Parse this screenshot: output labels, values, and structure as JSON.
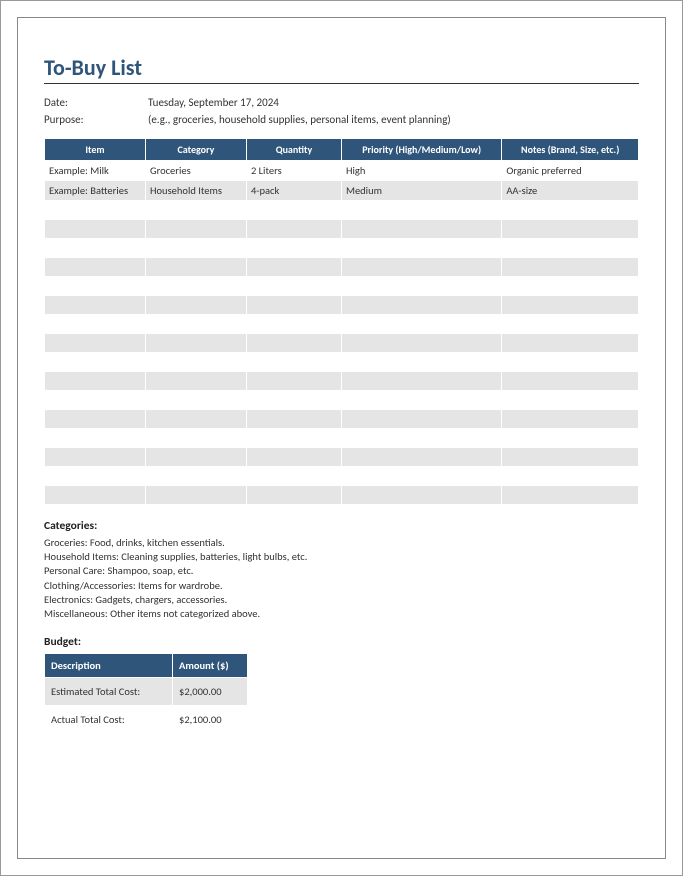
{
  "title": "To-Buy List",
  "meta": {
    "date_label": "Date:",
    "date_value": "Tuesday, September 17, 2024",
    "purpose_label": "Purpose:",
    "purpose_value": "(e.g., groceries, household supplies, personal items, event planning)"
  },
  "table": {
    "headers": {
      "item": "Item",
      "category": "Category",
      "quantity": "Quantity",
      "priority": "Priority (High/Medium/Low)",
      "notes": "Notes (Brand, Size, etc.)"
    },
    "rows": [
      {
        "item": "Example: Milk",
        "category": "Groceries",
        "quantity": "2 Liters",
        "priority": "High",
        "notes": "Organic preferred"
      },
      {
        "item": "Example: Batteries",
        "category": "Household Items",
        "quantity": "4-pack",
        "priority": "Medium",
        "notes": "AA-size"
      },
      {
        "item": "",
        "category": "",
        "quantity": "",
        "priority": "",
        "notes": ""
      },
      {
        "item": "",
        "category": "",
        "quantity": "",
        "priority": "",
        "notes": ""
      },
      {
        "item": "",
        "category": "",
        "quantity": "",
        "priority": "",
        "notes": ""
      },
      {
        "item": "",
        "category": "",
        "quantity": "",
        "priority": "",
        "notes": ""
      },
      {
        "item": "",
        "category": "",
        "quantity": "",
        "priority": "",
        "notes": ""
      },
      {
        "item": "",
        "category": "",
        "quantity": "",
        "priority": "",
        "notes": ""
      },
      {
        "item": "",
        "category": "",
        "quantity": "",
        "priority": "",
        "notes": ""
      },
      {
        "item": "",
        "category": "",
        "quantity": "",
        "priority": "",
        "notes": ""
      },
      {
        "item": "",
        "category": "",
        "quantity": "",
        "priority": "",
        "notes": ""
      },
      {
        "item": "",
        "category": "",
        "quantity": "",
        "priority": "",
        "notes": ""
      },
      {
        "item": "",
        "category": "",
        "quantity": "",
        "priority": "",
        "notes": ""
      },
      {
        "item": "",
        "category": "",
        "quantity": "",
        "priority": "",
        "notes": ""
      },
      {
        "item": "",
        "category": "",
        "quantity": "",
        "priority": "",
        "notes": ""
      },
      {
        "item": "",
        "category": "",
        "quantity": "",
        "priority": "",
        "notes": ""
      },
      {
        "item": "",
        "category": "",
        "quantity": "",
        "priority": "",
        "notes": ""
      },
      {
        "item": "",
        "category": "",
        "quantity": "",
        "priority": "",
        "notes": ""
      }
    ]
  },
  "categories": {
    "heading": "Categories:",
    "lines": [
      "Groceries: Food, drinks, kitchen essentials.",
      "Household Items: Cleaning supplies, batteries, light bulbs, etc.",
      "Personal Care: Shampoo, soap, etc.",
      "Clothing/Accessories: Items for wardrobe.",
      "Electronics: Gadgets, chargers, accessories.",
      "Miscellaneous: Other items not categorized above."
    ]
  },
  "budget": {
    "heading": "Budget:",
    "headers": {
      "desc": "Description",
      "amount": "Amount ($)"
    },
    "rows": [
      {
        "desc": "Estimated Total Cost:",
        "amount": "$2,000.00"
      },
      {
        "desc": "Actual Total Cost:",
        "amount": "$2,100.00"
      }
    ]
  }
}
